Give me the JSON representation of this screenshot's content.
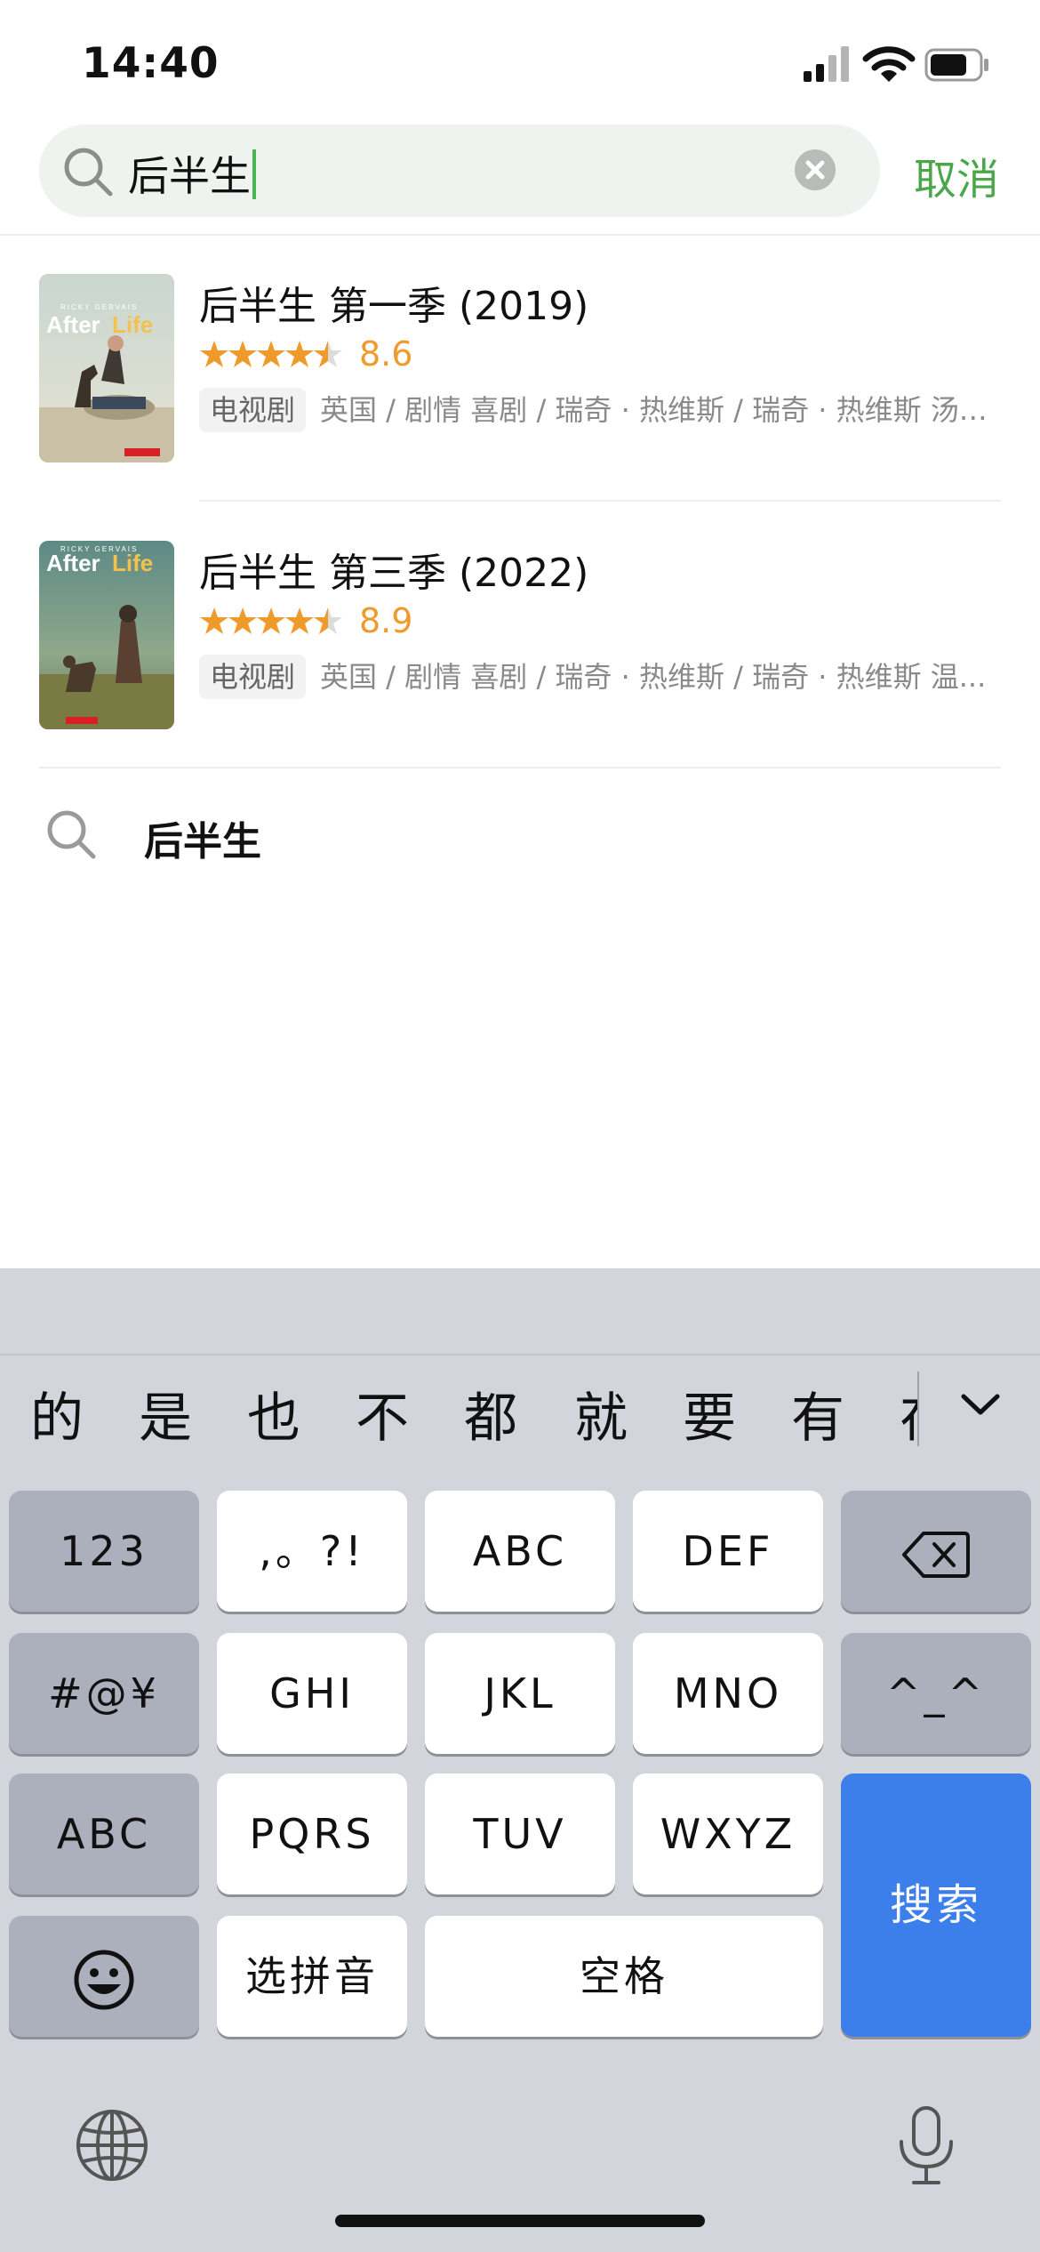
{
  "status_bar": {
    "time": "14:40"
  },
  "search": {
    "query": "后半生",
    "cancel_label": "取消"
  },
  "results": [
    {
      "title": "后半生 第一季 (2019)",
      "rating": "8.6",
      "stars": 4.5,
      "type": "电视剧",
      "meta": "英国 / 剧情 喜剧 / 瑞奇 · 热维斯 / 瑞奇 · 热维斯 汤姆·巴斯登",
      "poster_title": "After Life",
      "poster_actor": "RICKY GERVAIS"
    },
    {
      "title": "后半生 第三季 (2022)",
      "rating": "8.9",
      "stars": 4.5,
      "type": "电视剧",
      "meta": "英国 / 剧情 喜剧 / 瑞奇 · 热维斯 / 瑞奇 · 热维斯 温...",
      "poster_title": "After Life",
      "poster_actor": "RICKY GERVAIS"
    }
  ],
  "suggestion": {
    "text": "后半生"
  },
  "keyboard": {
    "candidates": [
      "的",
      "是",
      "也",
      "不",
      "都",
      "就",
      "要",
      "有",
      "在"
    ],
    "keys": {
      "num": "123",
      "punct": ",。?!",
      "abc": "ABC",
      "def": "DEF",
      "symbols": "#@¥",
      "ghi": "GHI",
      "jkl": "JKL",
      "mno": "MNO",
      "emoticon": "^_^",
      "abc_switch": "ABC",
      "pqrs": "PQRS",
      "tuv": "TUV",
      "wxyz": "WXYZ",
      "select_pinyin": "选拼音",
      "space": "空格",
      "search": "搜索"
    }
  },
  "colors": {
    "accent_green": "#4aa84a",
    "rating_orange": "#f09a2b",
    "search_key_blue": "#3c7eea"
  }
}
